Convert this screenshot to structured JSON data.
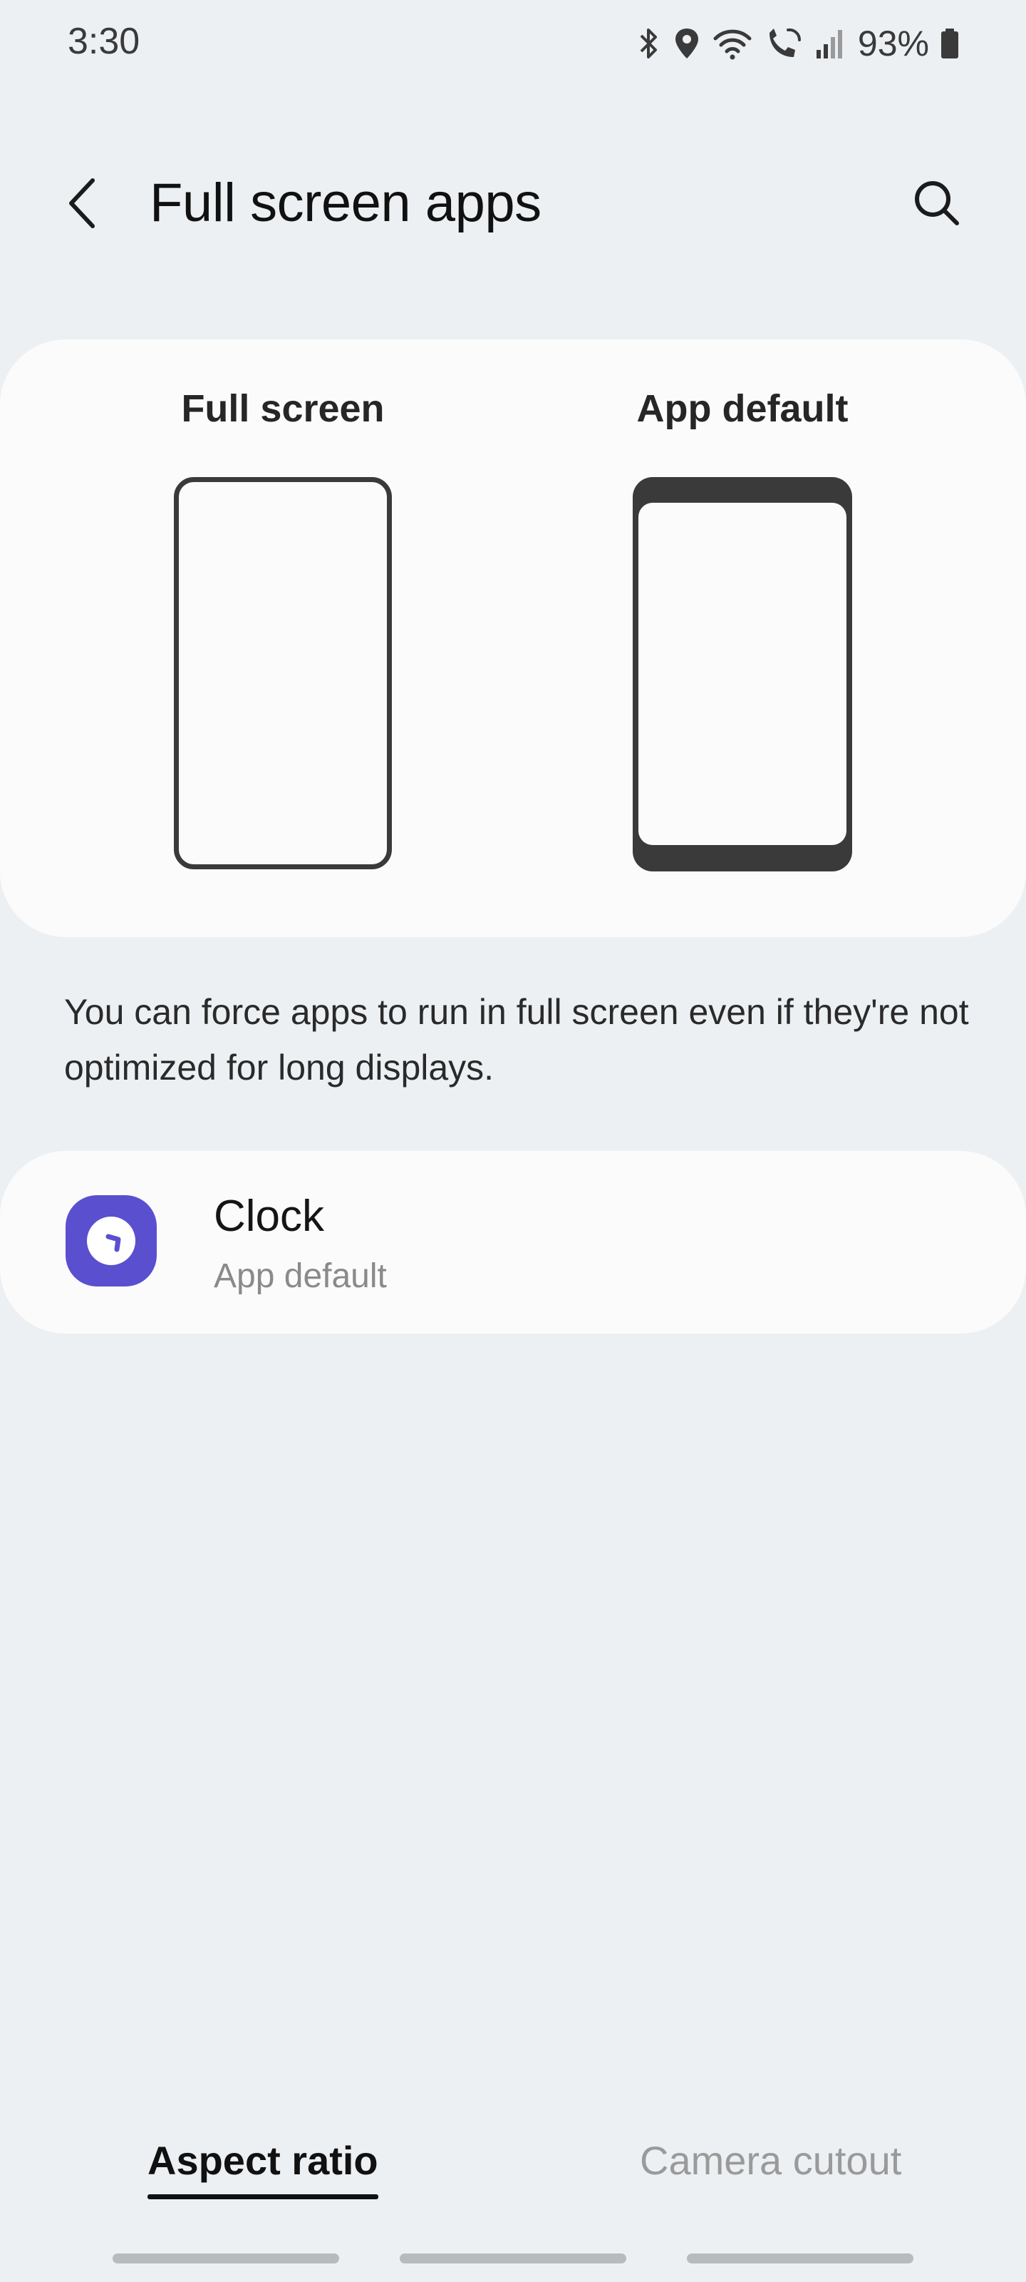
{
  "status_bar": {
    "time": "3:30",
    "battery": "93%",
    "icons": [
      "bluetooth-icon",
      "location-icon",
      "wifi-icon",
      "wifi-calling-icon",
      "signal-icon",
      "battery-icon"
    ]
  },
  "header": {
    "title": "Full screen apps",
    "back_icon": "back-chevron-icon",
    "search_icon": "search-icon"
  },
  "preview": {
    "options": [
      {
        "label": "Full screen"
      },
      {
        "label": "App default"
      }
    ]
  },
  "description": "You can force apps to run in full screen even if they're not optimized for long displays.",
  "apps": [
    {
      "name": "Clock",
      "setting": "App default",
      "icon": "clock-app-icon",
      "icon_color": "#5a4fcf"
    }
  ],
  "tabs": [
    {
      "label": "Aspect ratio",
      "selected": true
    },
    {
      "label": "Camera cutout",
      "selected": false
    }
  ],
  "colors": {
    "background": "#edf0f2",
    "card": "#fbfbfb",
    "accent_dark": "#3a3a3a",
    "clock_icon": "#5a4fcf"
  }
}
